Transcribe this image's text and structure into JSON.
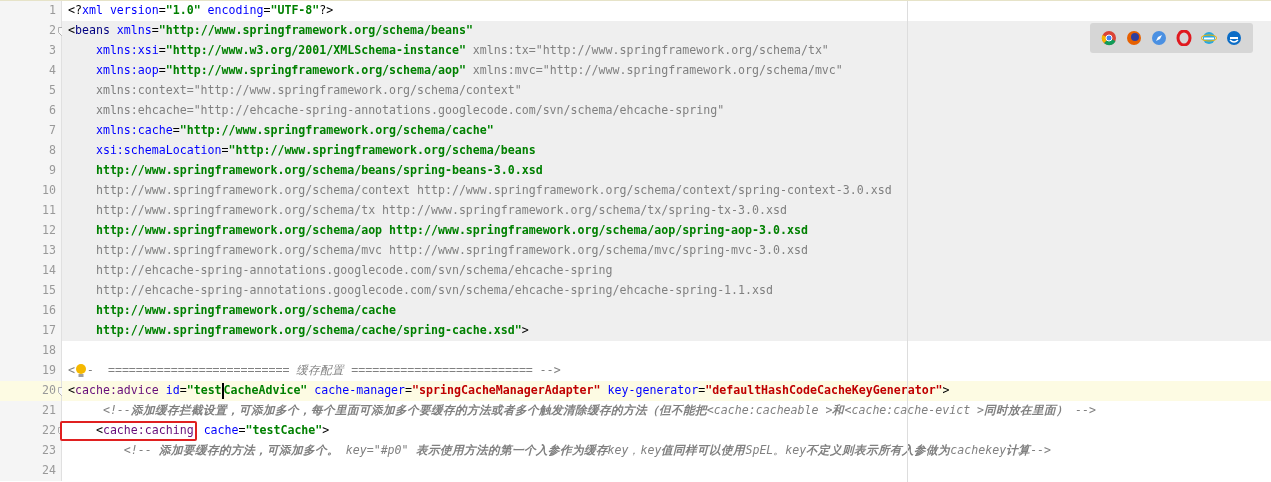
{
  "editor": {
    "lines": [
      {
        "number": "1",
        "shaded": false,
        "current": false,
        "fold": false,
        "tokens": [
          {
            "kind": "punct",
            "text": "<?"
          },
          {
            "kind": "attr",
            "text": "xml version"
          },
          {
            "kind": "punct",
            "text": "="
          },
          {
            "kind": "value",
            "text": "\"1.0\""
          },
          {
            "kind": "attr",
            "text": " encoding"
          },
          {
            "kind": "punct",
            "text": "="
          },
          {
            "kind": "value",
            "text": "\"UTF-8\""
          },
          {
            "kind": "punct",
            "text": "?>"
          }
        ]
      },
      {
        "number": "2",
        "shaded": true,
        "current": false,
        "fold": true,
        "tokens": [
          {
            "kind": "punct",
            "text": "<"
          },
          {
            "kind": "tag",
            "text": "beans"
          },
          {
            "kind": "attr",
            "text": " xmlns"
          },
          {
            "kind": "punct",
            "text": "="
          },
          {
            "kind": "value",
            "text": "\"http://www.springframework.org/schema/beans\""
          }
        ]
      },
      {
        "number": "3",
        "shaded": true,
        "current": false,
        "fold": false,
        "tokens": [
          {
            "kind": "attr",
            "text": "    xmlns:xsi"
          },
          {
            "kind": "punct",
            "text": "="
          },
          {
            "kind": "value",
            "text": "\"http://www.w3.org/2001/XMLSchema-instance\""
          },
          {
            "kind": "dim",
            "text": " xmlns:tx=\"http://www.springframework.org/schema/tx\""
          }
        ]
      },
      {
        "number": "4",
        "shaded": true,
        "current": false,
        "fold": false,
        "tokens": [
          {
            "kind": "attr",
            "text": "    xmlns:aop"
          },
          {
            "kind": "punct",
            "text": "="
          },
          {
            "kind": "value",
            "text": "\"http://www.springframework.org/schema/aop\""
          },
          {
            "kind": "dim",
            "text": " xmlns:mvc=\"http://www.springframework.org/schema/mvc\""
          }
        ]
      },
      {
        "number": "5",
        "shaded": true,
        "current": false,
        "fold": false,
        "tokens": [
          {
            "kind": "dim",
            "text": "    xmlns:context=\"http://www.springframework.org/schema/context\""
          }
        ]
      },
      {
        "number": "6",
        "shaded": true,
        "current": false,
        "fold": false,
        "tokens": [
          {
            "kind": "dim",
            "text": "    xmlns:ehcache=\"http://ehcache-spring-annotations.googlecode.com/svn/schema/ehcache-spring\""
          }
        ]
      },
      {
        "number": "7",
        "shaded": true,
        "current": false,
        "fold": false,
        "tokens": [
          {
            "kind": "attr",
            "text": "    xmlns:cache"
          },
          {
            "kind": "punct",
            "text": "="
          },
          {
            "kind": "value",
            "text": "\"http://www.springframework.org/schema/cache\""
          }
        ]
      },
      {
        "number": "8",
        "shaded": true,
        "current": false,
        "fold": false,
        "tokens": [
          {
            "kind": "attr",
            "text": "    xsi:schemaLocation"
          },
          {
            "kind": "punct",
            "text": "="
          },
          {
            "kind": "value",
            "text": "\"http://www.springframework.org/schema/beans"
          }
        ]
      },
      {
        "number": "9",
        "shaded": true,
        "current": false,
        "fold": false,
        "tokens": [
          {
            "kind": "value",
            "text": "    http://www.springframework.org/schema/beans/spring-beans-3.0.xsd"
          }
        ]
      },
      {
        "number": "10",
        "shaded": true,
        "current": false,
        "fold": false,
        "tokens": [
          {
            "kind": "dim",
            "text": "    http://www.springframework.org/schema/context http://www.springframework.org/schema/context/spring-context-3.0.xsd"
          }
        ]
      },
      {
        "number": "11",
        "shaded": true,
        "current": false,
        "fold": false,
        "tokens": [
          {
            "kind": "dim",
            "text": "    http://www.springframework.org/schema/tx http://www.springframework.org/schema/tx/spring-tx-3.0.xsd"
          }
        ]
      },
      {
        "number": "12",
        "shaded": true,
        "current": false,
        "fold": false,
        "tokens": [
          {
            "kind": "value",
            "text": "    http://www.springframework.org/schema/aop http://www.springframework.org/schema/aop/spring-aop-3.0.xsd"
          }
        ]
      },
      {
        "number": "13",
        "shaded": true,
        "current": false,
        "fold": false,
        "tokens": [
          {
            "kind": "dim",
            "text": "    http://www.springframework.org/schema/mvc http://www.springframework.org/schema/mvc/spring-mvc-3.0.xsd"
          }
        ]
      },
      {
        "number": "14",
        "shaded": true,
        "current": false,
        "fold": false,
        "tokens": [
          {
            "kind": "dim",
            "text": "    http://ehcache-spring-annotations.googlecode.com/svn/schema/ehcache-spring"
          }
        ]
      },
      {
        "number": "15",
        "shaded": true,
        "current": false,
        "fold": false,
        "tokens": [
          {
            "kind": "dim",
            "text": "    http://ehcache-spring-annotations.googlecode.com/svn/schema/ehcache-spring/ehcache-spring-1.1.xsd"
          }
        ]
      },
      {
        "number": "16",
        "shaded": true,
        "current": false,
        "fold": false,
        "tokens": [
          {
            "kind": "value",
            "text": "    http://www.springframework.org/schema/cache"
          }
        ]
      },
      {
        "number": "17",
        "shaded": true,
        "current": false,
        "fold": false,
        "tokens": [
          {
            "kind": "value",
            "text": "    http://www.springframework.org/schema/cache/spring-cache.xsd\""
          },
          {
            "kind": "punct",
            "text": ">"
          }
        ]
      },
      {
        "number": "18",
        "shaded": false,
        "current": false,
        "fold": false
      },
      {
        "number": "19",
        "shaded": false,
        "current": false,
        "fold": false,
        "tokens": [
          {
            "kind": "comment",
            "text": "<"
          },
          {
            "kind": "bulb"
          },
          {
            "kind": "comment",
            "text": "-  ========================== 缓存配置 ========================== -->"
          }
        ]
      },
      {
        "number": "20",
        "shaded": false,
        "current": true,
        "fold": true,
        "tokens": [
          {
            "kind": "punct",
            "text": "<"
          },
          {
            "kind": "ns",
            "text": "cache:advice"
          },
          {
            "kind": "attr",
            "text": " id"
          },
          {
            "kind": "punct",
            "text": "="
          },
          {
            "kind": "value",
            "text": "\"test"
          },
          {
            "kind": "caret"
          },
          {
            "kind": "value",
            "text": "CacheAdvice\""
          },
          {
            "kind": "attr",
            "text": " cache-manager"
          },
          {
            "kind": "punct",
            "text": "="
          },
          {
            "kind": "str2",
            "text": "\"springCacheManagerAdapter\""
          },
          {
            "kind": "attr",
            "text": " key-generator"
          },
          {
            "kind": "punct",
            "text": "="
          },
          {
            "kind": "str2",
            "text": "\"defaultHashCodeCacheKeyGenerator\""
          },
          {
            "kind": "punct",
            "text": ">"
          }
        ]
      },
      {
        "number": "21",
        "shaded": false,
        "current": false,
        "fold": false,
        "tokens": [
          {
            "kind": "comment",
            "text": "     <!--**添加缓存拦截设置，可添加多个，每个里面可添加多个要缓存的方法或者多个触发清除缓存的方法（但不能把**<cache:cacheable >**和**<cache:cache-evict >**同时放在里面）** -->"
          }
        ]
      },
      {
        "number": "22",
        "shaded": false,
        "current": false,
        "fold": true,
        "tokens": [
          {
            "kind": "punct",
            "text": "    <",
            "boxed": true
          },
          {
            "kind": "ns",
            "text": "cache:caching",
            "boxed": true
          },
          {
            "kind": "attr",
            "text": " cache"
          },
          {
            "kind": "punct",
            "text": "="
          },
          {
            "kind": "value",
            "text": "\"testCache\""
          },
          {
            "kind": "punct",
            "text": ">"
          }
        ]
      },
      {
        "number": "23",
        "shaded": false,
        "current": false,
        "fold": false,
        "tokens": [
          {
            "kind": "comment",
            "text": "        <!-- **添加要缓存的方法，可添加多个。** key=\"#p0\" **表示使用方法的第一个入参作为缓存**key，key**值同样可以使用**SpEL。key**不定义则表示所有入参做为**cachekey**计算**-->"
          }
        ]
      },
      {
        "number": "24",
        "shaded": false,
        "current": false,
        "fold": false
      }
    ]
  }
}
